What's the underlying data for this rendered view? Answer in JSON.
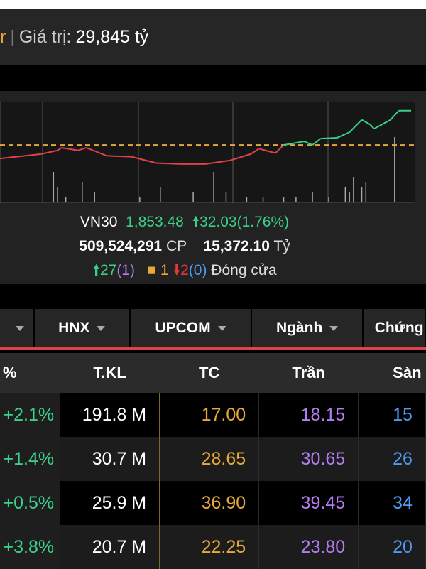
{
  "header": {
    "partial_label": "r",
    "separator": "|",
    "value_label": "Giá trị:",
    "value": "29,845 tỷ"
  },
  "index": {
    "name": "VN30",
    "value": "1,853.48",
    "change": "32.03(1.76%)",
    "volume": "509,524,291",
    "volume_unit": "CP",
    "turnover": "15,372.10",
    "turnover_unit": "Tỷ",
    "up": "27",
    "up_ceiling": "(1)",
    "unchanged": "1",
    "down": "2",
    "down_floor": "(0)",
    "status": "Đóng cửa"
  },
  "tabs": [
    {
      "label": ""
    },
    {
      "label": "HNX"
    },
    {
      "label": "UPCOM"
    },
    {
      "label": "Ngành"
    },
    {
      "label": "Chứng"
    }
  ],
  "table": {
    "headers": [
      "%",
      "T.KL",
      "TC",
      "Trần",
      "Sàn"
    ],
    "rows": [
      [
        "+2.1%",
        "191.8 M",
        "17.00",
        "18.15",
        "15"
      ],
      [
        "+1.4%",
        "30.7 M",
        "28.65",
        "30.65",
        "26"
      ],
      [
        "+0.5%",
        "25.9 M",
        "36.90",
        "39.45",
        "34"
      ],
      [
        "+3.8%",
        "20.7 M",
        "22.25",
        "23.80",
        "20"
      ]
    ]
  },
  "colors": {
    "up": "#3ad08a",
    "down": "#e0414a",
    "ref": "#e8a93a",
    "ceiling": "#b27bf0",
    "floor": "#4e9af0"
  },
  "chart_data": {
    "type": "line",
    "title": "VN30 intraday",
    "reference": 1821.45,
    "ylim": [
      1795,
      1858
    ],
    "x": [
      0,
      10,
      14,
      15,
      19,
      21,
      26,
      32,
      38,
      44,
      50,
      56,
      61,
      63,
      67,
      69,
      74,
      76,
      78,
      82,
      85,
      88,
      90,
      91,
      95,
      97,
      100
    ],
    "values": [
      1808.8,
      1813,
      1816.4,
      1818.9,
      1816.4,
      1818.9,
      1811.3,
      1810.5,
      1804.6,
      1803.7,
      1803.7,
      1807.1,
      1813,
      1818,
      1813.9,
      1821.45,
      1824.8,
      1821.45,
      1827.4,
      1828.2,
      1833.3,
      1845,
      1840.7,
      1836.6,
      1845,
      1853.5,
      1853.5
    ],
    "volume": [
      [
        13,
        6
      ],
      [
        14,
        3
      ],
      [
        16,
        1
      ],
      [
        20,
        4
      ],
      [
        23,
        2
      ],
      [
        34,
        1
      ],
      [
        39,
        3
      ],
      [
        47,
        2
      ],
      [
        52,
        6
      ],
      [
        55,
        2
      ],
      [
        60,
        1
      ],
      [
        64,
        1
      ],
      [
        69,
        1
      ],
      [
        72,
        1
      ],
      [
        76,
        2
      ],
      [
        80,
        1
      ],
      [
        84,
        3
      ],
      [
        85,
        2
      ],
      [
        86,
        5
      ],
      [
        88,
        3
      ],
      [
        89,
        4
      ],
      [
        96,
        13
      ]
    ]
  }
}
